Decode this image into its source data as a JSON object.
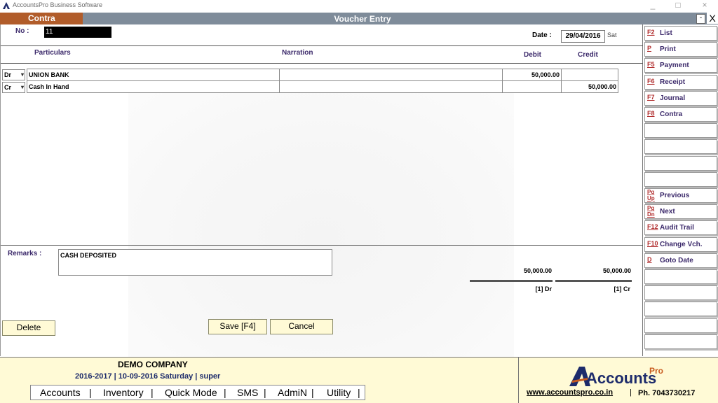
{
  "window": {
    "title": "AccountsPro Business Software",
    "controls": [
      "_",
      "□",
      "×"
    ]
  },
  "header": {
    "voucher_type": "Contra",
    "title": "Voucher Entry",
    "minimize_label": "-",
    "close_label": "X"
  },
  "voucher": {
    "no_label": "No :",
    "no_value": "11",
    "date_label": "Date :",
    "date_value": "29/04/2016",
    "day_value": "Sat"
  },
  "columns": {
    "particulars": "Particulars",
    "narration": "Narration",
    "debit": "Debit",
    "credit": "Credit"
  },
  "entries": [
    {
      "type": "Dr",
      "particulars": "UNION BANK",
      "narration": "",
      "debit": "50,000.00",
      "credit": ""
    },
    {
      "type": "Cr",
      "particulars": "Cash In Hand",
      "narration": "",
      "debit": "",
      "credit": "50,000.00"
    }
  ],
  "remarks": {
    "label": "Remarks :",
    "value": "CASH DEPOSITED"
  },
  "totals": {
    "debit": "50,000.00",
    "credit": "50,000.00",
    "debit_count": "[1] Dr",
    "credit_count": "[1] Cr"
  },
  "buttons": {
    "delete": "Delete",
    "save": "Save [F4]",
    "cancel": "Cancel"
  },
  "sidebar": [
    {
      "key": "F2",
      "label": "List"
    },
    {
      "key": "P",
      "label": "Print"
    },
    {
      "key": "F5",
      "label": "Payment"
    },
    {
      "key": "F6",
      "label": "Receipt"
    },
    {
      "key": "F7",
      "label": "Journal"
    },
    {
      "key": "F8",
      "label": "Contra"
    },
    {
      "key": "",
      "label": ""
    },
    {
      "key": "",
      "label": ""
    },
    {
      "key": "",
      "label": ""
    },
    {
      "key": "",
      "label": ""
    },
    {
      "key": "Pg Up",
      "label": "Previous"
    },
    {
      "key": "Pg Dn",
      "label": "Next"
    },
    {
      "key": "F12",
      "label": "Audit Trail"
    },
    {
      "key": "F10",
      "label": "Change Vch."
    },
    {
      "key": "D",
      "label": "Goto Date"
    },
    {
      "key": "",
      "label": ""
    },
    {
      "key": "",
      "label": ""
    },
    {
      "key": "",
      "label": ""
    },
    {
      "key": "",
      "label": ""
    },
    {
      "key": "",
      "label": ""
    }
  ],
  "footer": {
    "company": "DEMO COMPANY",
    "session": "2016-2017 | 10-09-2016 Saturday  |  super",
    "menu": [
      "Accounts",
      "Inventory",
      "Quick Mode",
      "SMS",
      "AdmiN",
      "Utility"
    ],
    "brand": "Accounts",
    "brand_sup": "Pro",
    "website": "www.accountspro.co.in",
    "phone": "Ph. 7043730217"
  },
  "colors": {
    "accent_tab": "#b15c2a",
    "header_bar": "#7f8c9a",
    "button_bg": "#fffad6",
    "label_text": "#3c2a6b",
    "hotkey_text": "#b12e2e"
  }
}
